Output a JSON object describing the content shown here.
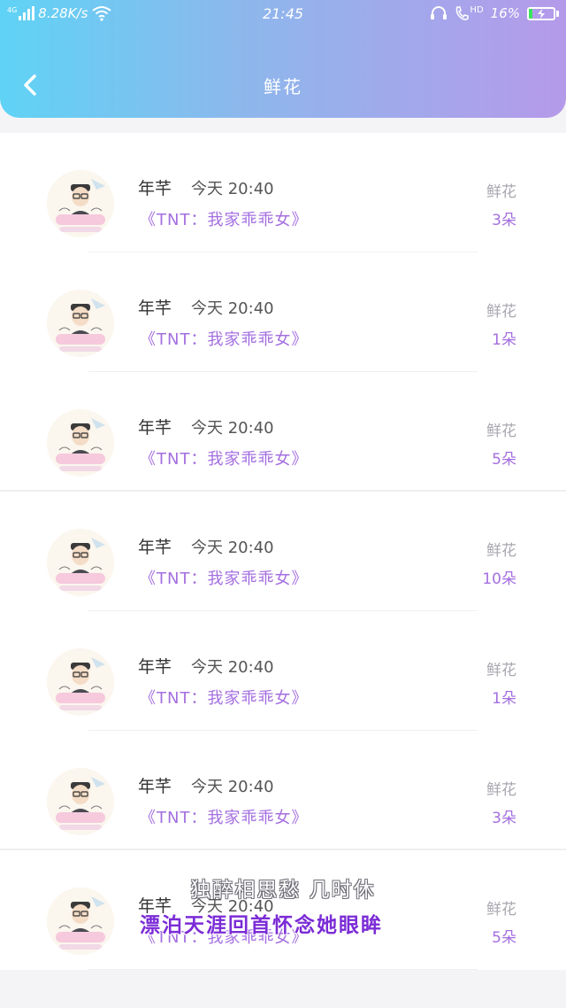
{
  "status_bar": {
    "network": "4G",
    "speed": "8.28K/s",
    "time": "21:45",
    "hd": "HD",
    "battery": "16%",
    "battery_level": 0.16
  },
  "header": {
    "title": "鲜花",
    "back_icon": "chevron-left-icon"
  },
  "rows": [
    {
      "name": "年芊",
      "time": "今天 20:40",
      "book": "《TNT：我家乖乖女》",
      "label": "鲜花",
      "count": "3朵"
    },
    {
      "name": "年芊",
      "time": "今天 20:40",
      "book": "《TNT：我家乖乖女》",
      "label": "鲜花",
      "count": "1朵"
    },
    {
      "name": "年芊",
      "time": "今天 20:40",
      "book": "《TNT：我家乖乖女》",
      "label": "鲜花",
      "count": "5朵"
    },
    {
      "name": "年芊",
      "time": "今天 20:40",
      "book": "《TNT：我家乖乖女》",
      "label": "鲜花",
      "count": "10朵"
    },
    {
      "name": "年芊",
      "time": "今天 20:40",
      "book": "《TNT：我家乖乖女》",
      "label": "鲜花",
      "count": "1朵"
    },
    {
      "name": "年芊",
      "time": "今天 20:40",
      "book": "《TNT：我家乖乖女》",
      "label": "鲜花",
      "count": "3朵"
    },
    {
      "name": "年芊",
      "time": "今天 20:40",
      "book": "《TNT：我家乖乖女》",
      "label": "鲜花",
      "count": "5朵"
    }
  ],
  "overlay_lyrics": {
    "line1": "独醉相思愁 几时休",
    "line2": "漂泊天涯回首怀念她眼眸"
  },
  "colors": {
    "accent": "#a46fe0",
    "header_start": "#5fd3f5",
    "header_end": "#b59aea",
    "battery_fill": "#3be35c"
  }
}
